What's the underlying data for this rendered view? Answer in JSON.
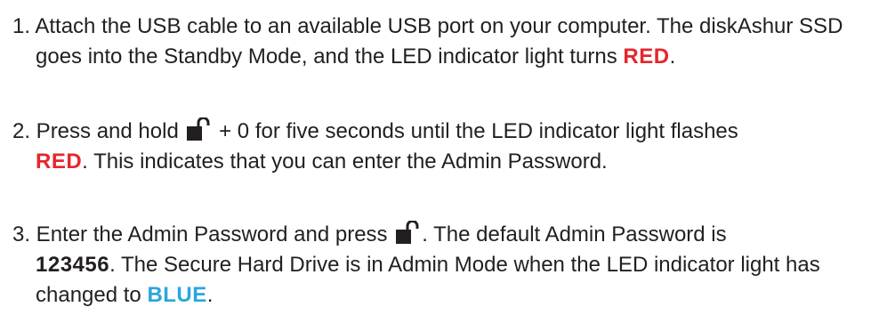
{
  "colors": {
    "text": "#231f20",
    "red": "#e4272c",
    "blue": "#2aa6dc"
  },
  "steps": [
    {
      "line1": "1. Attach the USB cable to an available USB port on your computer. The diskAshur SSD",
      "line2_pre": "goes into the Standby Mode, and the LED indicator light turns ",
      "line2_red": "RED",
      "line2_post": "."
    },
    {
      "line1_pre": "2. Press and hold ",
      "icon": "unlock-icon",
      "line1_post": " + 0 for five seconds until the LED indicator light flashes",
      "line2_red": "RED",
      "line2_post": ". This indicates that you can enter the Admin Password."
    },
    {
      "line1_pre": "3. Enter the Admin Password and press ",
      "icon": "unlock-icon",
      "line1_post": ". The default Admin Password is",
      "line2_bold": "123456",
      "line2_post": ". The Secure Hard Drive is in Admin Mode when the LED indicator light has",
      "line3_pre": "changed to ",
      "line3_blue": "BLUE",
      "line3_post": "."
    }
  ]
}
